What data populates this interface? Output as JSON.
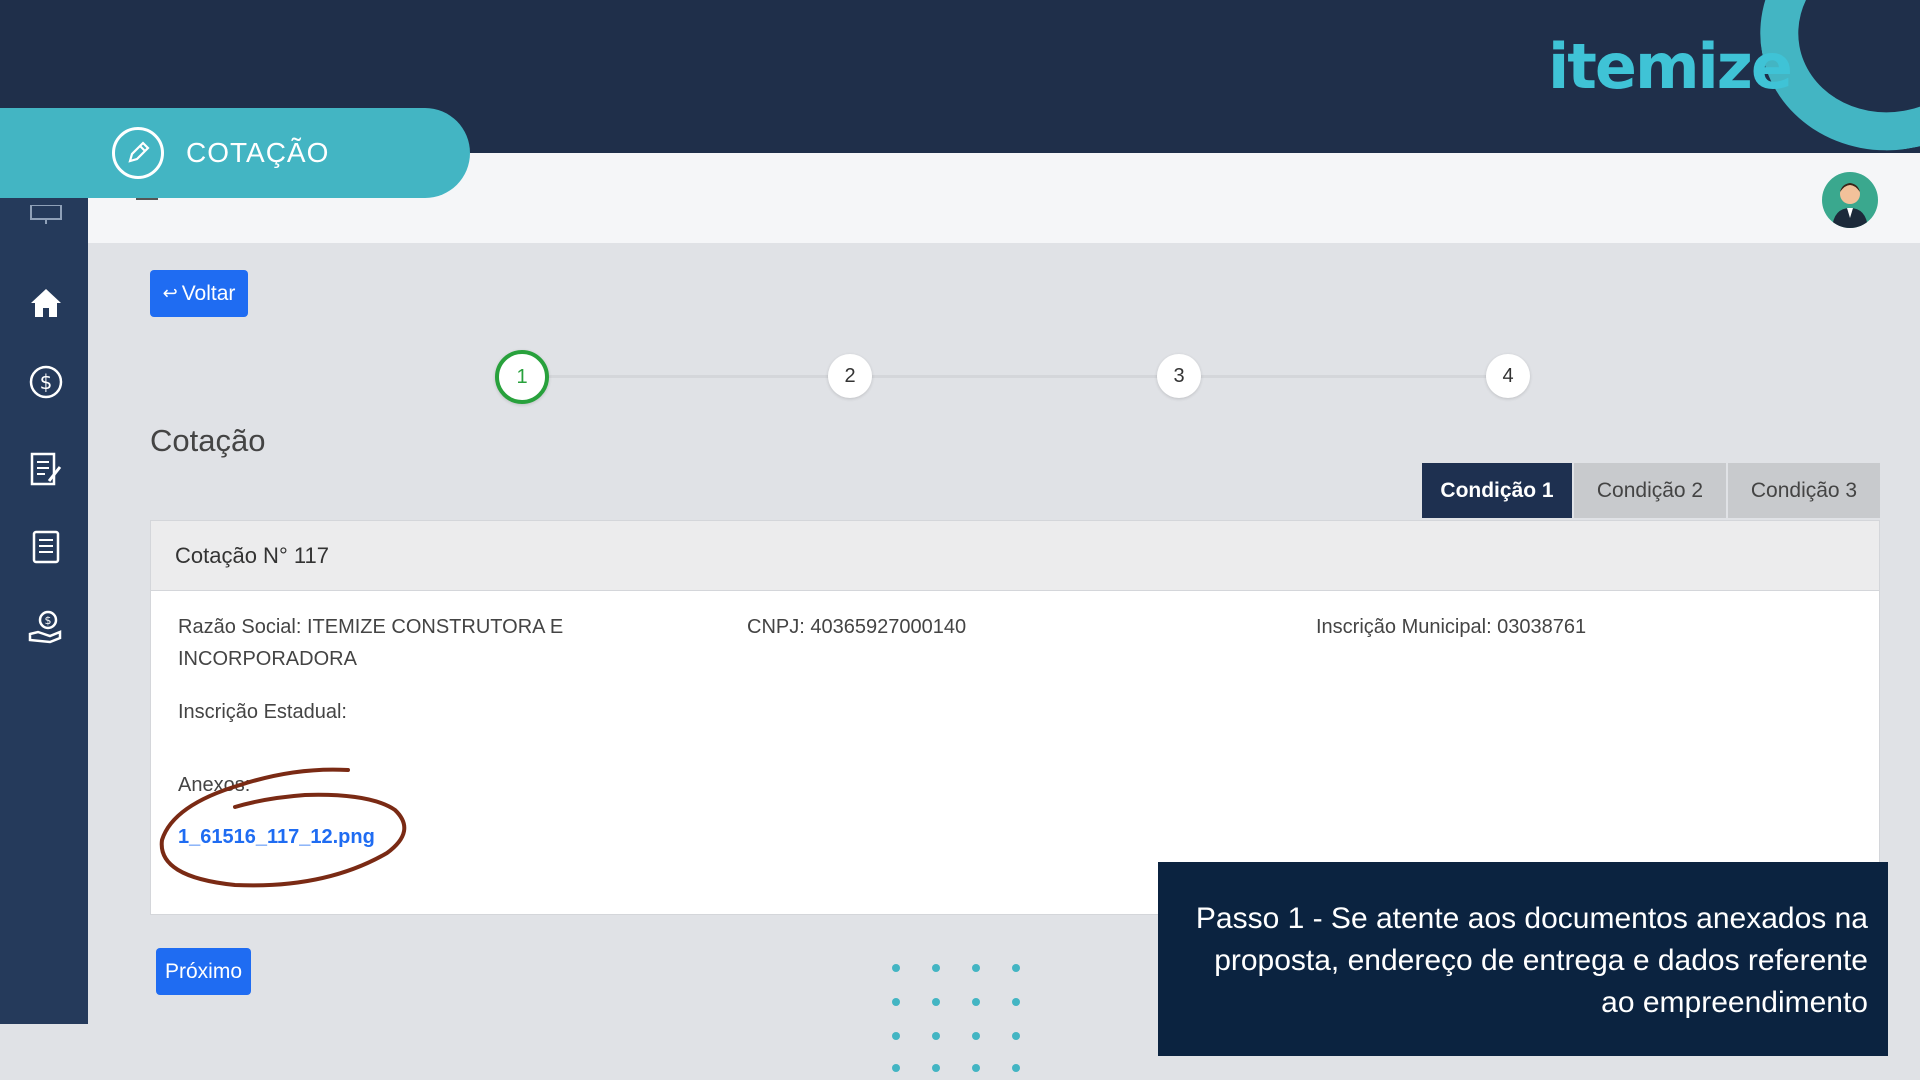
{
  "brand": {
    "logo": "itemize",
    "accent": "#43b5c3",
    "dark": "#1f2f4a"
  },
  "banner": {
    "title": "COTAÇÃO",
    "icon": "pencil-icon"
  },
  "sidebar": {
    "items": [
      {
        "icon": "monitor-chart-icon"
      },
      {
        "icon": "home-icon"
      },
      {
        "icon": "dollar-icon"
      },
      {
        "icon": "document-edit-icon"
      },
      {
        "icon": "document-list-icon"
      },
      {
        "icon": "gear-money-icon"
      }
    ]
  },
  "toolbar": {
    "back_label": "Voltar",
    "next_label": "Próximo"
  },
  "stepper": {
    "steps": [
      "1",
      "2",
      "3",
      "4"
    ],
    "active": 1
  },
  "page": {
    "title": "Cotação"
  },
  "tabs": [
    "Condição 1",
    "Condição 2",
    "Condição 3"
  ],
  "card": {
    "header": "Cotação N° 117",
    "razao_social": "Razão Social: ITEMIZE CONSTRUTORA E INCORPORADORA",
    "cnpj": "CNPJ: 40365927000140",
    "inscricao_municipal": "Inscrição Municipal: 03038761",
    "inscricao_estadual": "Inscrição Estadual:",
    "anexos_label": "Anexos:",
    "anexo_file": "1_61516_117_12.png"
  },
  "caption": {
    "text": "Passo 1 - Se atente aos documentos anexados na proposta, endereço de entrega e dados referente ao empreendimento"
  }
}
